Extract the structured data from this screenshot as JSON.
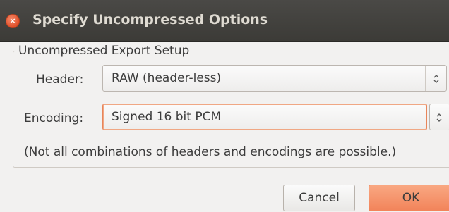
{
  "window": {
    "title": "Specify Uncompressed Options",
    "close_glyph": "×"
  },
  "group": {
    "title": "Uncompressed Export Setup"
  },
  "header": {
    "label": "Header:",
    "value": "RAW (header-less)"
  },
  "encoding": {
    "label": "Encoding:",
    "value": "Signed 16 bit PCM"
  },
  "note": "(Not all combinations of headers and encodings are possible.)",
  "buttons": {
    "cancel": "Cancel",
    "ok": "OK"
  },
  "colors": {
    "titlebar": "#3c3b37",
    "accent": "#f2845a",
    "close": "#e0502a"
  },
  "icons": {
    "close": "close-icon",
    "combo_arrows": "up-down-arrows-icon"
  }
}
